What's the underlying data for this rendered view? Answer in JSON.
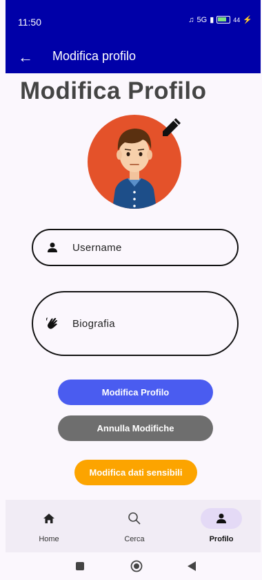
{
  "status_bar": {
    "time": "11:50",
    "network": "5G",
    "battery": "44"
  },
  "app_bar": {
    "title": "Modifica profilo",
    "back_icon": "arrow-left-icon"
  },
  "page": {
    "title": "Modifica Profilo"
  },
  "avatar": {
    "edit_icon": "pencil-icon",
    "background_color": "#e4522a"
  },
  "fields": {
    "username": {
      "placeholder": "Username",
      "icon": "person-icon"
    },
    "bio": {
      "placeholder": "Biografia",
      "icon": "waving-hand-icon"
    }
  },
  "buttons": {
    "modifica_profilo": {
      "label": "Modifica Profilo",
      "color": "#4a5cf0"
    },
    "annulla_modifiche": {
      "label": "Annulla Modifiche",
      "color": "#6e6e6e"
    },
    "modifica_dati_sensibili": {
      "label": "Modifica dati sensibili",
      "color": "#fca400"
    }
  },
  "bottom_nav": {
    "items": [
      {
        "label": "Home",
        "icon": "home-icon",
        "selected": false
      },
      {
        "label": "Cerca",
        "icon": "search-icon",
        "selected": false
      },
      {
        "label": "Profilo",
        "icon": "person-icon",
        "selected": true
      }
    ]
  },
  "colors": {
    "app_bar": "#0000a8",
    "background": "#fbf7fd",
    "nav_background": "#f1ecf5",
    "nav_selected": "#e4daf6"
  }
}
